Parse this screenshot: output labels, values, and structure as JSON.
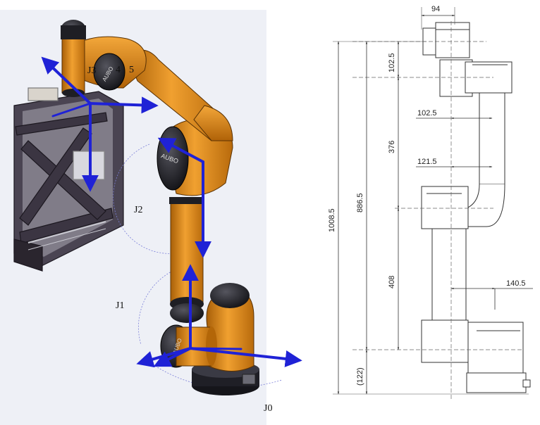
{
  "left_panel": {
    "background": "#eef0f6",
    "arm_color": "#e08a18",
    "arm_dark": "#1e1e24",
    "frame_color": "#3a3440",
    "axis_color": "#1f22d6",
    "joint_labels": {
      "j0": "J0",
      "j1": "J1",
      "j2": "J2",
      "j3": "J3",
      "j4": "4",
      "j5": "5"
    },
    "logo_text": "AUBO"
  },
  "right_panel": {
    "line_color": "#333333",
    "dims": {
      "d94": "94",
      "d102_5_top": "102.5",
      "d102_5_side": "102.5",
      "d376": "376",
      "d121_5": "121.5",
      "d1008_5": "1008.5",
      "d886_5": "886.5",
      "d408": "408",
      "d140_5": "140.5",
      "d122": "(122)"
    }
  }
}
